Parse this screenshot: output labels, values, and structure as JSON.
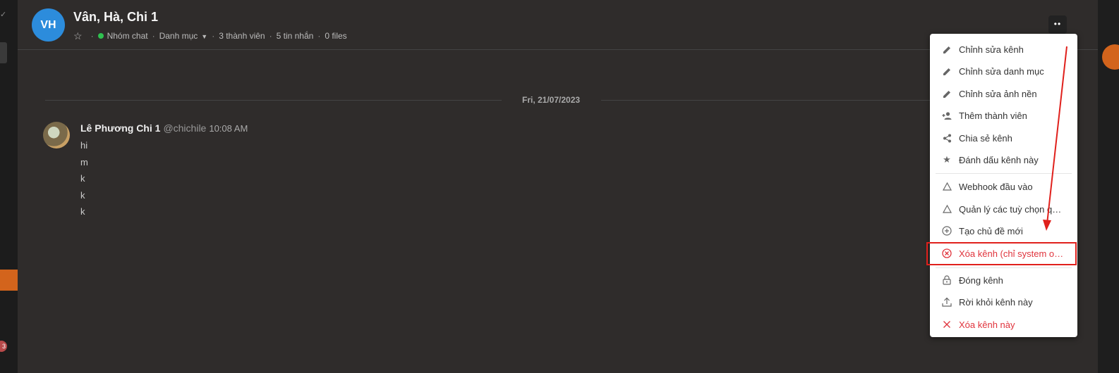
{
  "channel": {
    "avatar_initials": "VH",
    "title": "Vân, Hà, Chi 1",
    "type": "Nhóm chat",
    "category": "Danh mục",
    "members": "3 thành viên",
    "messages": "5 tin nhắn",
    "files": "0 files",
    "kebab": "••"
  },
  "date_separator": "Fri, 21/07/2023",
  "message": {
    "author": "Lê Phương Chi 1",
    "username": "@chichile",
    "time": "10:08 AM",
    "lines": [
      "hi",
      "m",
      "k",
      "k",
      "k"
    ]
  },
  "left_badge": "3",
  "menu": {
    "items": [
      {
        "label": "Chỉnh sửa kênh",
        "icon": "pencil-icon"
      },
      {
        "label": "Chỉnh sửa danh mục",
        "icon": "pencil-icon"
      },
      {
        "label": "Chỉnh sửa ảnh nền",
        "icon": "pencil-icon"
      },
      {
        "label": "Thêm thành viên",
        "icon": "add-person-icon"
      },
      {
        "label": "Chia sẻ kênh",
        "icon": "share-icon"
      },
      {
        "label": "Đánh dấu kênh này",
        "icon": "star-icon"
      },
      {
        "label": "Webhook đầu vào",
        "icon": "triangle-icon"
      },
      {
        "label": "Quản lý các tuỳ chọn quả...",
        "icon": "triangle-icon"
      },
      {
        "label": "Tạo chủ đề mới",
        "icon": "plus-circle-icon"
      },
      {
        "label": "Xóa kênh (chỉ system ow...",
        "icon": "x-circle-icon"
      },
      {
        "label": "Đóng kênh",
        "icon": "lock-icon"
      },
      {
        "label": "Rời khỏi kênh này",
        "icon": "upload-icon"
      },
      {
        "label": "Xóa kênh này",
        "icon": "x-icon"
      }
    ]
  },
  "colors": {
    "accent_blue": "#2c8cdc",
    "danger_red": "#e0333c",
    "annotation_red": "#e0201c",
    "online_green": "#2fc14f",
    "brand_orange": "#d3641c"
  }
}
